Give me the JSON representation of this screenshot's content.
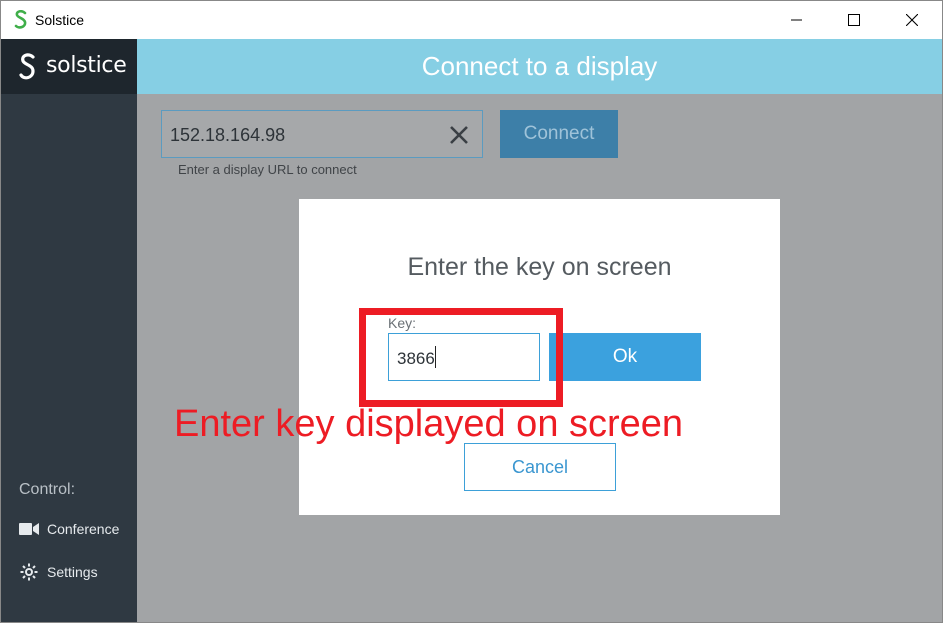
{
  "window": {
    "title": "Solstice",
    "icon": "solstice-logo-icon",
    "controls": [
      "minimize-icon",
      "maximize-icon",
      "close-icon"
    ]
  },
  "sidebar": {
    "brand_name": "solstice",
    "control_label": "Control:",
    "items": [
      {
        "label": "Conference",
        "icon": "video-camera-icon"
      },
      {
        "label": "Settings",
        "icon": "gear-icon"
      }
    ]
  },
  "header": {
    "title": "Connect to a display"
  },
  "main": {
    "url_input": {
      "value": "152.18.164.98"
    },
    "connect_label": "Connect",
    "hint": "Enter a display URL to connect"
  },
  "modal": {
    "title": "Enter the key on screen",
    "key_label": "Key:",
    "key_value": "3866",
    "ok_label": "Ok",
    "cancel_label": "Cancel"
  },
  "annotation": {
    "text": "Enter key displayed on screen",
    "color": "#ed1c24"
  },
  "colors": {
    "header_bg": "#86cfe4",
    "sidebar_bg": "#2f3942",
    "ok_button": "#3ba1de",
    "connect_button": "#3d7fa8"
  }
}
